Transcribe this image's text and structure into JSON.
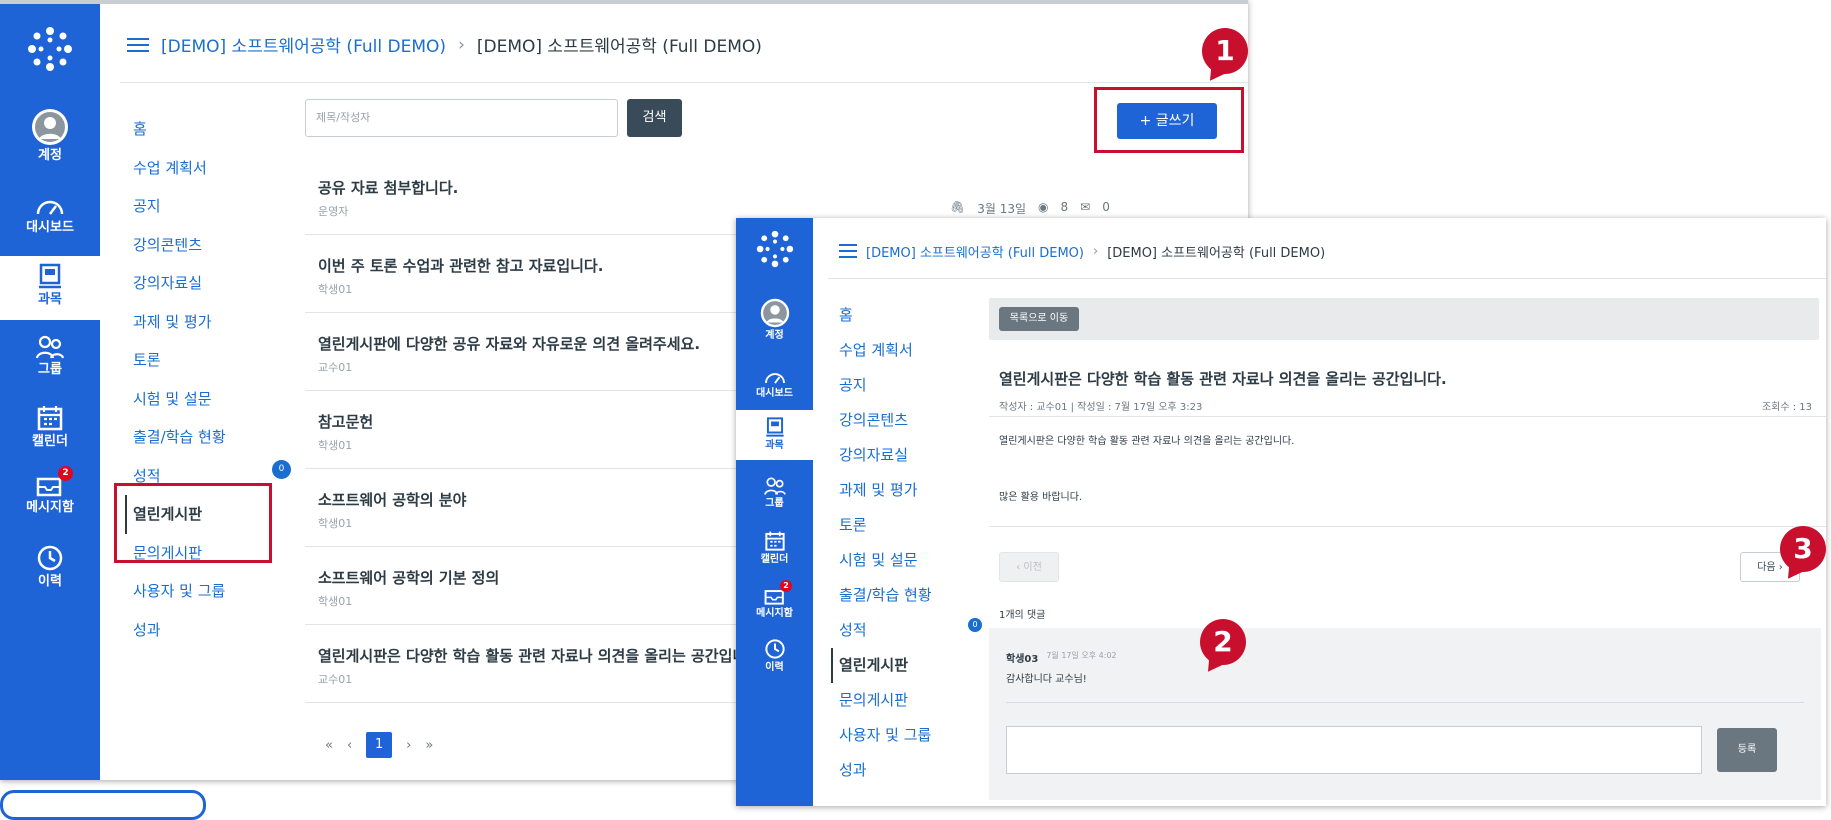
{
  "rail": {
    "account": "계정",
    "dashboard": "대시보드",
    "courses": "과목",
    "groups": "그룹",
    "calendar": "캘린더",
    "inbox": "메시지함",
    "inbox_count": "2",
    "history": "이력"
  },
  "breadcrumb": {
    "course": "[DEMO] 소프트웨어공학 (Full DEMO)",
    "separator": "›",
    "current": "[DEMO] 소프트웨어공학 (Full DEMO)"
  },
  "course_nav": [
    "홈",
    "수업 계획서",
    "공지",
    "강의콘텐츠",
    "강의자료실",
    "과제 및 평가",
    "토론",
    "시험 및 설문",
    "출결/학습 현황",
    "성적",
    "열린게시판",
    "문의게시판",
    "사용자 및 그룹",
    "성과"
  ],
  "grades_badge": "0",
  "search": {
    "placeholder": "제목/작성자",
    "button": "검색"
  },
  "write_button": "+ 글쓰기",
  "posts": [
    {
      "title": "공유 자료 첨부합니다.",
      "author": "운영자"
    },
    {
      "title": "이번 주 토론 수업과 관련한 참고 자료입니다.",
      "author": "학생01"
    },
    {
      "title": "열린게시판에 다양한 공유 자료와 자유로운 의견 올려주세요.",
      "author": "교수01"
    },
    {
      "title": "참고문헌",
      "author": "학생01"
    },
    {
      "title": "소프트웨어 공학의 분야",
      "author": "학생01"
    },
    {
      "title": "소프트웨어 공학의 기본 정의",
      "author": "학생01"
    },
    {
      "title": "열린게시판은 다양한 학습 활동 관련 자료나 의견을 올리는 공간입니다.",
      "author": "교수01"
    }
  ],
  "first_post_meta": {
    "date": "3월 13일",
    "views": "8",
    "comments": "0"
  },
  "pagination": {
    "first": "«",
    "prev": "‹",
    "current": "1",
    "next": "›",
    "last": "»"
  },
  "detail": {
    "back_button": "목록으로 이동",
    "title": "열린게시판은 다양한 학습 활동 관련 자료나 의견을 올리는 공간입니다.",
    "meta": "작성자 : 교수01 | 작성일 : 7월 17일 오후 3:23",
    "views": "조회수 : 13",
    "body_line1": "열린게시판은 다양한 학습 활동 관련 자료나 의견을 올리는 공간입니다.",
    "body_line2": "많은 활용 바랍니다.",
    "prev_button": "‹ 이전",
    "next_button": "다음 ›",
    "comment_count": "1개의 댓글",
    "comment_author": "학생03",
    "comment_time": "7월 17일 오후 4:02",
    "comment_text": "감사합니다 교수님!",
    "submit_button": "등록"
  },
  "markers": [
    "1",
    "2",
    "3"
  ],
  "colors": {
    "rail": "#1f64d6",
    "link": "#1b6ed0",
    "highlight": "#c8102e"
  }
}
